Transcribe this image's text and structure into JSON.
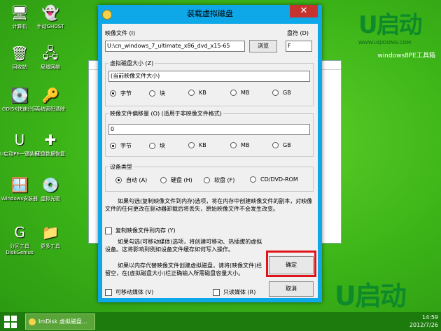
{
  "desktop": {
    "icons": [
      {
        "label": "计算机",
        "glyph": "🖥",
        "icon": "computer-icon"
      },
      {
        "label": "手动GHOST",
        "glyph": "👻",
        "icon": "ghost-icon"
      },
      {
        "label": "回收站",
        "glyph": "🗑",
        "icon": "recycle-bin-icon"
      },
      {
        "label": "局域网络",
        "glyph": "🖧",
        "icon": "network-icon"
      },
      {
        "label": "GDISK快速分区",
        "glyph": "💽",
        "icon": "disk-icon"
      },
      {
        "label": "系统密码清除",
        "glyph": "🔑",
        "icon": "key-icon"
      },
      {
        "label": "U启动PE一键装机",
        "glyph": "U",
        "icon": "u-install-icon"
      },
      {
        "label": "硬盘数据恢复",
        "glyph": "✚",
        "icon": "medkit-icon"
      },
      {
        "label": "Windows安装器",
        "glyph": "🪟",
        "icon": "windows-installer-icon"
      },
      {
        "label": "虚拟光驱",
        "glyph": "💿",
        "icon": "virtual-drive-icon"
      },
      {
        "label": "分区工具DiskGenius",
        "glyph": "G",
        "icon": "diskgenius-icon"
      },
      {
        "label": "更多工具",
        "glyph": "📁",
        "icon": "folder-icon"
      }
    ]
  },
  "brand": {
    "name": "U启动",
    "url": "WWW.UQIDONG.COM",
    "subtitle": "windows8PE工具箱"
  },
  "dialog": {
    "title": "装载虚拟磁盘",
    "close_glyph": "✕",
    "image_file_label": "映像文件 (I)",
    "image_file_value": "U:\\cn_windows_7_ultimate_x86_dvd_x15-65",
    "browse_label": "浏览",
    "drive_label": "盘符 (D)",
    "drive_value": "F",
    "size_group": {
      "title": "虚拟磁盘大小 (Z)",
      "value": "(当前映像文件大小)",
      "units": [
        "字节",
        "块",
        "KB",
        "MB",
        "GB"
      ],
      "selected": "字节"
    },
    "offset_group": {
      "title": "映像文件偏移量 (O)  (适用于非映像文件格式)",
      "value": "0",
      "units": [
        "字节",
        "块",
        "KB",
        "MB",
        "GB"
      ],
      "selected": "字节"
    },
    "device_group": {
      "title": "设备类型",
      "options": [
        "自动 (A)",
        "硬盘 (H)",
        "软盘 (F)",
        "CD/DVD-ROM"
      ],
      "selected": "自动 (A)"
    },
    "para1": "如果勾选(复制映像文件到内存)选项，将在内存中创建映像文件的副本，对映像文件的任何更改在驱动器卸载后将丢失，原始映像文件不会发生改变。",
    "copy_to_memory_label": "复制映像文件到内存 (Y)",
    "para2": "如果勾选(可移动媒体)选项，将创建可移动、热插拔的虚拟设备。这将影响到例如设备文件缓存如何写入操作。",
    "para3": "如果以内存代替映像文件创建虚拟磁盘，请将(映像文件)栏留空，在(虚拟磁盘大小)栏正确输入所需磁盘容量大小。",
    "removable_label": "可移动媒体 (V)",
    "readonly_label": "只读媒体 (R)",
    "ok_label": "确定",
    "cancel_label": "取消",
    "highlight_color": "#e0141b"
  },
  "taskbar": {
    "task_label": "ImDisk 虚拟磁盘...",
    "time": "14:59",
    "date": "2012/7/26"
  }
}
